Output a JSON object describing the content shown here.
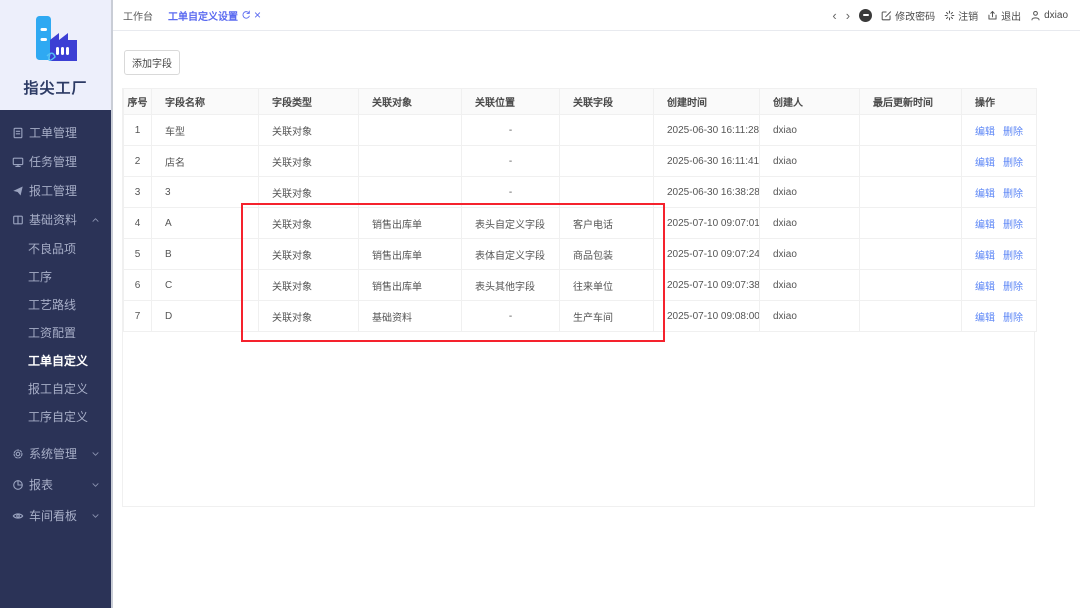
{
  "app": {
    "logo_title": "指尖工厂"
  },
  "sidebar": {
    "items": [
      {
        "label": "工单管理",
        "icon": "document-icon"
      },
      {
        "label": "任务管理",
        "icon": "monitor-icon"
      },
      {
        "label": "报工管理",
        "icon": "send-icon"
      },
      {
        "label": "基础资料",
        "icon": "book-icon",
        "expanded": true
      },
      {
        "label": "不良品项"
      },
      {
        "label": "工序"
      },
      {
        "label": "工艺路线"
      },
      {
        "label": "工资配置"
      },
      {
        "label": "工单自定义",
        "active": true
      },
      {
        "label": "报工自定义"
      },
      {
        "label": "工序自定义"
      },
      {
        "label": "系统管理",
        "icon": "gear-icon",
        "expanded": false
      },
      {
        "label": "报表",
        "icon": "pie-chart-icon",
        "expanded": false
      },
      {
        "label": "车间看板",
        "icon": "eye-icon",
        "expanded": false
      }
    ]
  },
  "topbar": {
    "tabs": [
      {
        "label": "工作台"
      },
      {
        "label": "工单自定义设置",
        "active": true
      }
    ],
    "glyphs": {
      "prev": "‹",
      "next": "›",
      "close": "×"
    },
    "actions": {
      "change_password": "修改密码",
      "logout": "注销",
      "exit": "退出",
      "username": "dxiao"
    }
  },
  "toolbar": {
    "add_field_label": "添加字段"
  },
  "table": {
    "headers": [
      "序号",
      "字段名称",
      "字段类型",
      "关联对象",
      "关联位置",
      "关联字段",
      "创建时间",
      "创建人",
      "最后更新时间",
      "操作"
    ],
    "action_edit": "编辑",
    "action_delete": "删除",
    "empty_dash": "-",
    "rows": [
      {
        "seq": "1",
        "name": "车型",
        "type": "关联对象",
        "target": "",
        "position": "-",
        "field": "",
        "created_at": "2025-06-30 16:11:28",
        "creator": "dxiao",
        "updated_at": ""
      },
      {
        "seq": "2",
        "name": "店名",
        "type": "关联对象",
        "target": "",
        "position": "-",
        "field": "",
        "created_at": "2025-06-30 16:11:41",
        "creator": "dxiao",
        "updated_at": ""
      },
      {
        "seq": "3",
        "name": "3",
        "type": "关联对象",
        "target": "",
        "position": "-",
        "field": "",
        "created_at": "2025-06-30 16:38:28",
        "creator": "dxiao",
        "updated_at": ""
      },
      {
        "seq": "4",
        "name": "A",
        "type": "关联对象",
        "target": "销售出库单",
        "position": "表头自定义字段",
        "field": "客户电话",
        "created_at": "2025-07-10 09:07:01",
        "creator": "dxiao",
        "updated_at": ""
      },
      {
        "seq": "5",
        "name": "B",
        "type": "关联对象",
        "target": "销售出库单",
        "position": "表体自定义字段",
        "field": "商品包装",
        "created_at": "2025-07-10 09:07:24",
        "creator": "dxiao",
        "updated_at": ""
      },
      {
        "seq": "6",
        "name": "C",
        "type": "关联对象",
        "target": "销售出库单",
        "position": "表头其他字段",
        "field": "往来单位",
        "created_at": "2025-07-10 09:07:38",
        "creator": "dxiao",
        "updated_at": ""
      },
      {
        "seq": "7",
        "name": "D",
        "type": "关联对象",
        "target": "基础资料",
        "position": "-",
        "field": "生产车间",
        "created_at": "2025-07-10 09:08:00",
        "creator": "dxiao",
        "updated_at": ""
      }
    ]
  },
  "colors": {
    "sidebar_bg": "#2b3357",
    "logo_bg": "#edeffb",
    "accent_tab_blue": "#5a6af0",
    "link_blue": "#5b85f6",
    "highlight_red": "#f5222d",
    "logo_light_blue": "#2fa9f2",
    "logo_indigo": "#3c3fd4"
  }
}
